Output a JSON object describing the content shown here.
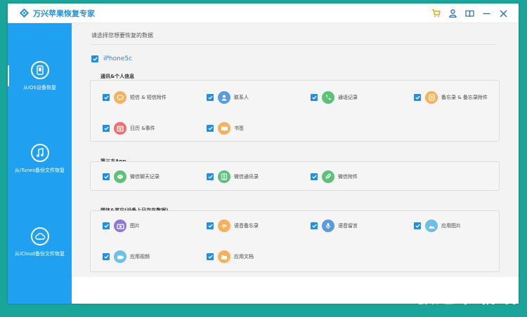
{
  "app": {
    "title": "万兴苹果恢复专家",
    "logo": "diamond-logo-icon",
    "accent_color": "#1f90e6"
  },
  "window_controls": [
    {
      "name": "cart-icon",
      "color": "#f0a020"
    },
    {
      "name": "user-icon",
      "color": "#2a73c4"
    },
    {
      "name": "book-icon",
      "color": "#2a73c4"
    },
    {
      "name": "minimize-icon",
      "color": "#2a73c4"
    },
    {
      "name": "close-icon",
      "color": "#2a73c4"
    }
  ],
  "sidebar": {
    "items": [
      {
        "label": "从iOS设备恢复",
        "icon": "phone-icon"
      },
      {
        "label": "从iTunes备份文件恢复",
        "icon": "music-note-icon"
      },
      {
        "label": "从iCloud备份文件恢复",
        "icon": "cloud-icon"
      }
    ]
  },
  "main": {
    "prompt": "请选择您想要恢复的数据",
    "device": {
      "label": "iPhone5c",
      "checked": true
    },
    "groups": [
      {
        "title": "通讯&个人信息",
        "items": [
          {
            "label": "短信 & 短信附件",
            "icon": "message-icon",
            "color": "#f6b15a",
            "checked": true
          },
          {
            "label": "联系人",
            "icon": "contact-icon",
            "color": "#5a9be0",
            "checked": true
          },
          {
            "label": "通话记录",
            "icon": "phone-call-icon",
            "color": "#5cc27a",
            "checked": true
          },
          {
            "label": "备忘录 & 备忘录附件",
            "icon": "memo-icon",
            "color": "#f6b15a",
            "checked": true
          },
          {
            "label": "日历 &事件",
            "icon": "calendar-icon",
            "color": "#ef6f6f",
            "checked": true
          },
          {
            "label": "书签",
            "icon": "bookmark-icon",
            "color": "#f6b15a",
            "checked": true
          }
        ]
      },
      {
        "title": "第三方App",
        "items": [
          {
            "label": "微信聊天记录",
            "icon": "wechat-chat-icon",
            "color": "#5cc27a",
            "checked": true
          },
          {
            "label": "微信通讯录",
            "icon": "wechat-contacts-icon",
            "color": "#5cc27a",
            "checked": true
          },
          {
            "label": "微信附件",
            "icon": "wechat-attachment-icon",
            "color": "#5cc27a",
            "checked": true
          }
        ]
      },
      {
        "title": "媒体&其它(设备上已存在数据)",
        "items": [
          {
            "label": "图片",
            "icon": "camera-icon",
            "color": "#8f77d6",
            "checked": true
          },
          {
            "label": "语音备忘录",
            "icon": "voice-memo-icon",
            "color": "#f6b15a",
            "checked": true
          },
          {
            "label": "语音留言",
            "icon": "microphone-icon",
            "color": "#5a9be0",
            "checked": true
          },
          {
            "label": "应用图片",
            "icon": "app-photo-icon",
            "color": "#6cc0e8",
            "checked": true
          },
          {
            "label": "应用视频",
            "icon": "app-video-icon",
            "color": "#6cc0e8",
            "checked": true
          },
          {
            "label": "应用文档",
            "icon": "app-document-icon",
            "color": "#f6b15a",
            "checked": true
          }
        ]
      }
    ]
  },
  "watermark": "极速下载站"
}
